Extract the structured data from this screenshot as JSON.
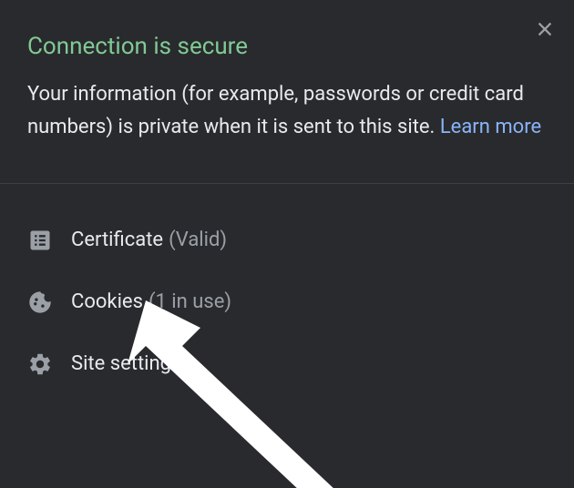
{
  "header": {
    "title": "Connection is secure",
    "description_text": "Your information (for example, passwords or credit card numbers) is private when it is sent to this site. ",
    "learn_more_label": "Learn more"
  },
  "menu": {
    "certificate": {
      "label": "Certificate",
      "status": "(Valid)"
    },
    "cookies": {
      "label": "Cookies",
      "status": "(1 in use)"
    },
    "site_settings": {
      "label": "Site settings"
    }
  },
  "colors": {
    "background": "#292a2d",
    "title": "#81c995",
    "text": "#e8eaed",
    "muted": "#9aa0a6",
    "link": "#8ab4f8",
    "divider": "#3c4043"
  }
}
